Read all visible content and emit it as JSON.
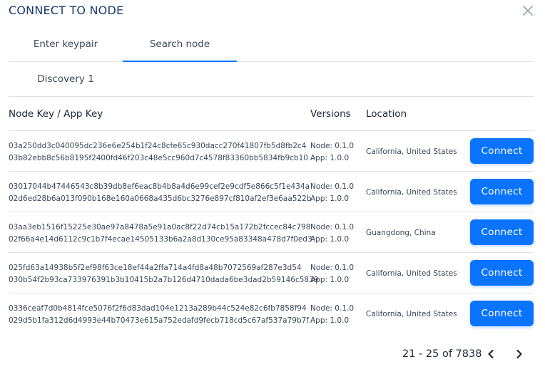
{
  "dialog": {
    "title": "CONNECT TO NODE",
    "close_icon": "close-icon"
  },
  "tabs": [
    {
      "label": "Enter keypair",
      "active": false
    },
    {
      "label": "Search node",
      "active": true
    }
  ],
  "subtabs": [
    {
      "label": "Discovery 1"
    }
  ],
  "table": {
    "headers": {
      "key": "Node Key / App Key",
      "versions": "Versions",
      "location": "Location"
    },
    "rows": [
      {
        "node_key": "03a250dd3c040095dc236e6e254b1f24c8cfe65c930dacc270f41807fb5d8fb2c4",
        "app_key": "03b82ebb8c56b8195f2400fd46f203c48e5cc960d7c4578f83360bb5834fb9cb10",
        "node_version": "Node: 0.1.0",
        "app_version": "App: 1.0.0",
        "location": "California, United States",
        "button": "Connect"
      },
      {
        "node_key": "03017044b47446543c8b39db8ef6eac8b4b8a4d6e99cef2e9cdf5e866c5f1e434a",
        "app_key": "02d6ed28b6a013f090b168e160a0668a435d6bc3276e897cf810af2ef3e6aa522b",
        "node_version": "Node: 0.1.0",
        "app_version": "App: 1.0.0",
        "location": "California, United States",
        "button": "Connect"
      },
      {
        "node_key": "03aa3eb1516f15225e30ae97a8478a5e91a0ac8f22d74cb15a172b2fccec84c798",
        "app_key": "02f66a4e14d6112c9c1b7f4ecae14505133b6a2a8d130ce95a83348a478d7f0ed3",
        "node_version": "Node: 0.1.0",
        "app_version": "App: 1.0.0",
        "location": "Guangdong, China",
        "button": "Connect"
      },
      {
        "node_key": "025fd63a14938b5f2ef98f63ce18ef44a2ffa714a4fd8a48b7072569af287e3d54",
        "app_key": "030b54f2b93ca733976391b3b10415b2a7b126d4710dada6be3dad2b59146c5839",
        "node_version": "Node: 0.1.0",
        "app_version": "App: 1.0.0",
        "location": "California, United States",
        "button": "Connect"
      },
      {
        "node_key": "0336ceaf7d0b4814fce5076f2f6d83dad104e1213a289b44c524e82c6fb7858f94",
        "app_key": "029d5b1fa312d6d4993e44b70473e615a752edafd9fecb718cd5c67af537a79b7f",
        "node_version": "Node: 0.1.0",
        "app_version": "App: 1.0.0",
        "location": "California, United States",
        "button": "Connect"
      }
    ]
  },
  "pagination": {
    "label": "21 - 25 of 7838",
    "prev_icon": "chevron-left-icon",
    "next_icon": "chevron-right-icon"
  },
  "colors": {
    "accent": "#0a74ff",
    "title": "#1b3b6f",
    "divider": "#dfe3e8"
  }
}
